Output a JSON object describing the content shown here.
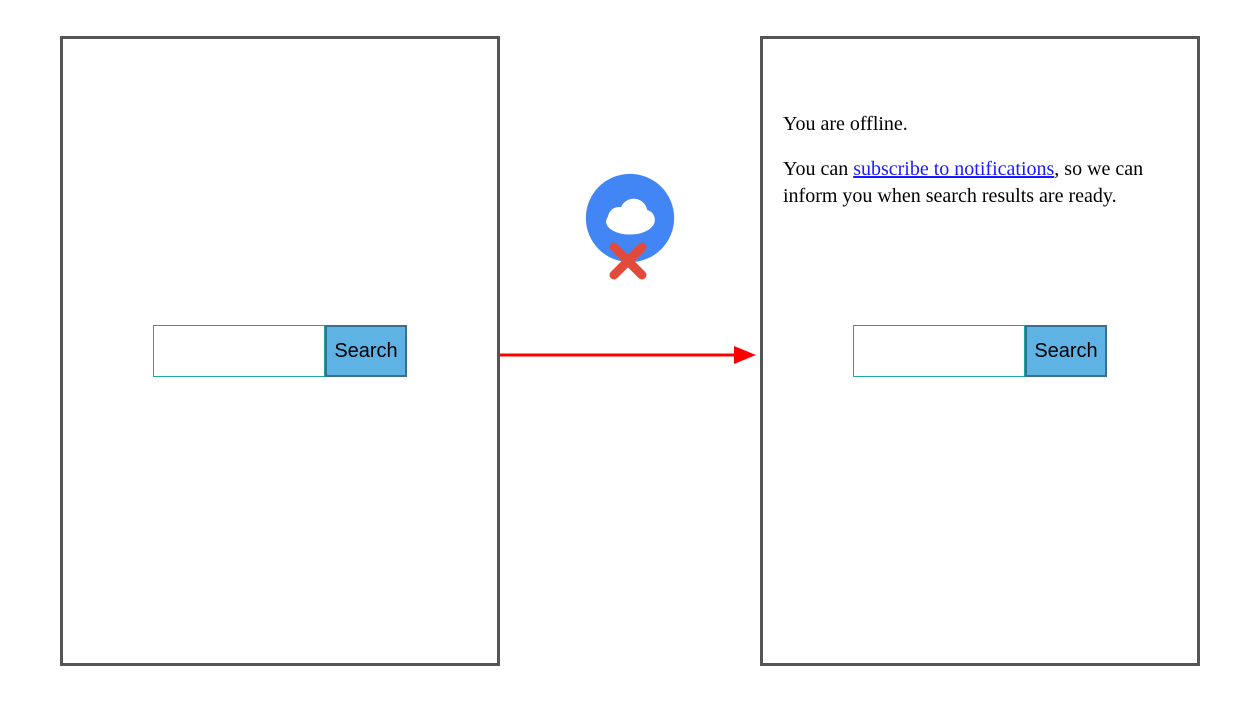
{
  "left": {
    "search_input_value": "",
    "search_button_label": "Search"
  },
  "right": {
    "search_input_value": "",
    "search_button_label": "Search",
    "offline_line": "You are offline.",
    "subscribe_prefix": "You can ",
    "subscribe_link": "subscribe to notifications",
    "subscribe_suffix": ", so we can inform you when search results are ready."
  },
  "icons": {
    "cloud_name": "cloud-offline-icon",
    "cloud_color": "#4285f4",
    "x_color": "#e24a3b",
    "arrow_color": "#ff0000"
  }
}
